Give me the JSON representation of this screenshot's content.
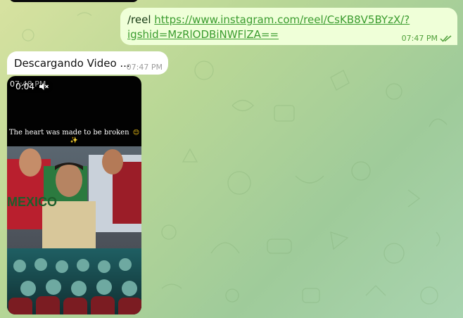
{
  "chat": {
    "outgoing": {
      "command": "/reel",
      "link": "https://www.instagram.com/reel/CsKB8V5BYzX/?igshid=MzRlODBiNWFlZA==",
      "time": "07:47 PM",
      "status_icon": "double-check-icon"
    },
    "incoming": {
      "text": "Descargando Video ...",
      "time": "07:47 PM"
    },
    "video": {
      "duration": "0:04",
      "muted_icon": "speaker-muted-icon",
      "caption": "The heart was made to be broken",
      "caption_emoji": "😊✨",
      "time": "07:48 PM"
    }
  },
  "colors": {
    "outgoing_bubble": "#efffd8",
    "incoming_bubble": "#ffffff",
    "link": "#3b9c2f",
    "outgoing_time": "#4f9f3a"
  }
}
